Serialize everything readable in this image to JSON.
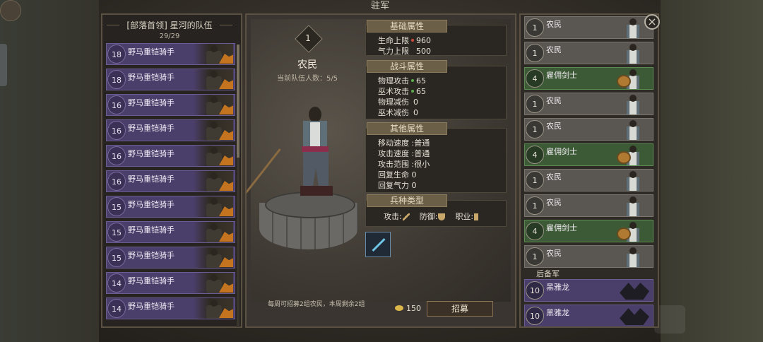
{
  "window_title": "驻军",
  "left_panel": {
    "title": "[部落首领] 星河的队伍",
    "count": "29/29",
    "units": [
      {
        "level": "18",
        "name": "野马重铠骑手"
      },
      {
        "level": "18",
        "name": "野马重铠骑手"
      },
      {
        "level": "16",
        "name": "野马重铠骑手"
      },
      {
        "level": "16",
        "name": "野马重铠骑手"
      },
      {
        "level": "16",
        "name": "野马重铠骑手"
      },
      {
        "level": "16",
        "name": "野马重铠骑手"
      },
      {
        "level": "15",
        "name": "野马重铠骑手"
      },
      {
        "level": "15",
        "name": "野马重铠骑手"
      },
      {
        "level": "15",
        "name": "野马重铠骑手"
      },
      {
        "level": "14",
        "name": "野马重铠骑手"
      },
      {
        "level": "14",
        "name": "野马重铠骑手"
      }
    ]
  },
  "center": {
    "rank": "1",
    "name": "农民",
    "team_count": "当前队伍人数：5/5",
    "basic": {
      "title": "基础属性",
      "hp_label": "生命上限",
      "hp_value": "960",
      "qi_label": "气力上限",
      "qi_value": "500"
    },
    "combat": {
      "title": "战斗属性",
      "phys_atk_label": "物理攻击",
      "phys_atk_value": "65",
      "magic_atk_label": "巫术攻击",
      "magic_atk_value": "65",
      "phys_red_label": "物理减伤",
      "phys_red_value": "0",
      "magic_red_label": "巫术减伤",
      "magic_red_value": "0"
    },
    "other": {
      "title": "其他属性",
      "move_speed": "移动速度 :普通",
      "atk_speed": "攻击速度 :普通",
      "atk_range": "攻击范围 :很小",
      "hp_regen": "回复生命  0",
      "qi_regen": "回复气力  0"
    },
    "troop_type": {
      "title": "兵种类型",
      "attack_label": "攻击:",
      "defense_label": "防御:",
      "job_label": "职业:"
    },
    "recruit_note": "每周可招募2组农民，本周剩余2组",
    "cost": "150",
    "recruit_button": "招募"
  },
  "right_panel": {
    "units": [
      {
        "level": "1",
        "name": "农民",
        "kind": "peasant"
      },
      {
        "level": "1",
        "name": "农民",
        "kind": "peasant"
      },
      {
        "level": "4",
        "name": "雇佣剑士",
        "kind": "merc"
      },
      {
        "level": "1",
        "name": "农民",
        "kind": "peasant"
      },
      {
        "level": "1",
        "name": "农民",
        "kind": "peasant"
      },
      {
        "level": "4",
        "name": "雇佣剑士",
        "kind": "merc"
      },
      {
        "level": "1",
        "name": "农民",
        "kind": "peasant"
      },
      {
        "level": "1",
        "name": "农民",
        "kind": "peasant"
      },
      {
        "level": "4",
        "name": "雇佣剑士",
        "kind": "merc"
      },
      {
        "level": "1",
        "name": "农民",
        "kind": "peasant"
      }
    ],
    "reserve_label": "后备军",
    "reserve": [
      {
        "level": "10",
        "name": "黑雅龙"
      },
      {
        "level": "10",
        "name": "黑雅龙"
      }
    ]
  },
  "close_icon": "close-icon",
  "colors": {
    "rider_row": "#4a3f6a",
    "merc_row": "#3d5a36",
    "peasant_row": "#5a5752",
    "stat_dot_hp": "#d04a3a",
    "stat_dot_atk": "#5ab04a",
    "coin": "#d9b54a"
  }
}
